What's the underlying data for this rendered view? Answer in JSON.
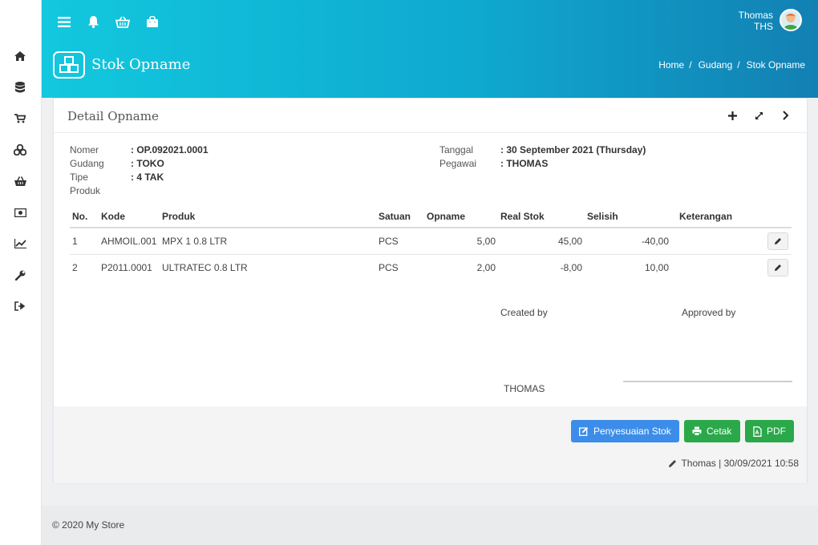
{
  "header": {
    "user_name": "Thomas",
    "user_code": "THS",
    "page_title": "Stok Opname",
    "breadcrumb": [
      "Home",
      "Gudang",
      "Stok Opname"
    ]
  },
  "sidebar": {
    "items": [
      "home-icon",
      "database-icon",
      "cart-icon",
      "boxes-icon",
      "basket-icon",
      "money-icon",
      "chart-icon",
      "wrench-icon",
      "sign-out-icon"
    ]
  },
  "card": {
    "title": "Detail Opname",
    "info": {
      "nomer_label": "Nomer",
      "nomer_value": ": OP.092021.0001",
      "gudang_label": "Gudang",
      "gudang_value": ": TOKO",
      "tipe_label": "Tipe",
      "tipe_value": ": 4 TAK",
      "produk_label": "Produk",
      "tanggal_label": "Tanggal",
      "tanggal_value": ": 30 September 2021 (Thursday)",
      "pegawai_label": "Pegawai",
      "pegawai_value": ": THOMAS"
    },
    "table": {
      "headers": [
        "No.",
        "Kode",
        "Produk",
        "Satuan",
        "Opname",
        "Real Stok",
        "Selisih",
        "Keterangan"
      ],
      "rows": [
        [
          "1",
          "AHMOIL.001",
          "MPX 1 0.8 LTR",
          "PCS",
          "5,00",
          "45,00",
          "-40,00",
          ""
        ],
        [
          "2",
          "P2011.0001",
          "ULTRATEC 0.8 LTR",
          "PCS",
          "2,00",
          "-8,00",
          "10,00",
          ""
        ]
      ]
    },
    "signature": {
      "created_label": "Created by",
      "approved_label": "Approved by",
      "created_name": "THOMAS"
    },
    "buttons": {
      "adjust": "Penyesuaian Stok",
      "print": "Cetak",
      "pdf": "PDF"
    },
    "audit": "Thomas | 30/09/2021 10:58"
  },
  "footer": {
    "copyright": "© 2020 My Store"
  },
  "colors": {
    "accent": "#12c8de",
    "primary": "#3c8dea",
    "success": "#2aa84a",
    "danger": "#d43a3a"
  }
}
